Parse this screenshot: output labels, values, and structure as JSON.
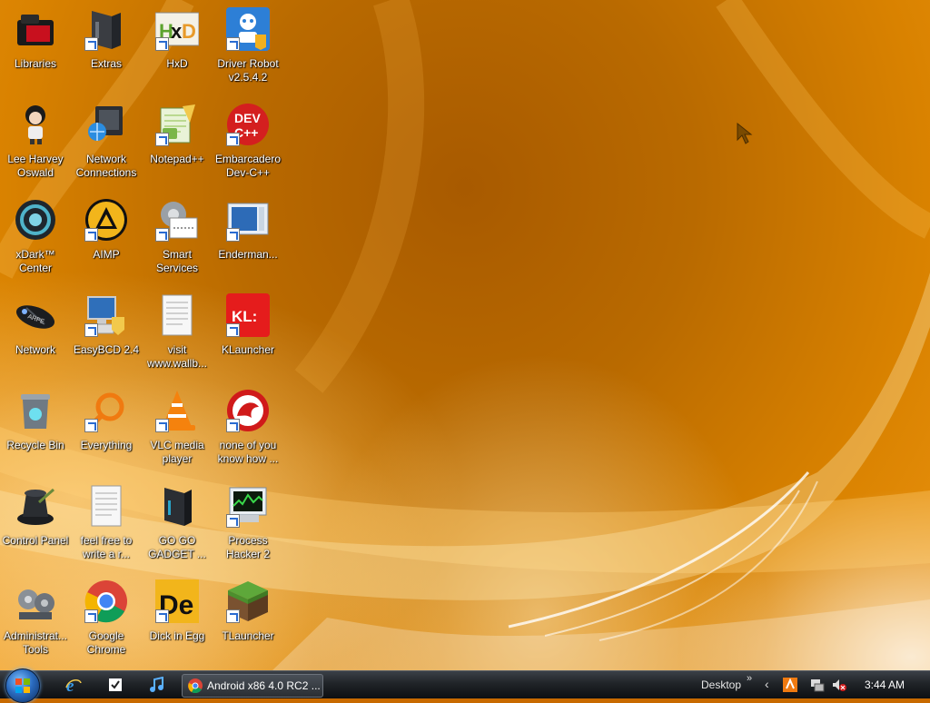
{
  "desktop": {
    "icons": [
      {
        "label": "Libraries",
        "icon": "libraries-icon"
      },
      {
        "label": "Extras",
        "icon": "folder-icon"
      },
      {
        "label": "HxD",
        "icon": "hxd-icon"
      },
      {
        "label": "Driver Robot\nv2.5.4.2",
        "icon": "driver-robot-icon"
      },
      {
        "label": "Lee Harvey\nOswald",
        "icon": "person-icon"
      },
      {
        "label": "Network\nConnections",
        "icon": "network-connections-icon"
      },
      {
        "label": "Notepad++",
        "icon": "notepad-icon"
      },
      {
        "label": "Embarcadero\nDev-C++",
        "icon": "devcpp-icon"
      },
      {
        "label": "xDark™\nCenter",
        "icon": "xdark-icon"
      },
      {
        "label": "AIMP",
        "icon": "aimp-icon"
      },
      {
        "label": "Smart\nServices",
        "icon": "gear-icon"
      },
      {
        "label": "Enderman...",
        "icon": "window-icon"
      },
      {
        "label": "Network",
        "icon": "network-icon"
      },
      {
        "label": "EasyBCD 2.4",
        "icon": "easybcd-icon"
      },
      {
        "label": "visit\nwww.wallb...",
        "icon": "document-icon"
      },
      {
        "label": "KLauncher",
        "icon": "klauncher-icon"
      },
      {
        "label": "Recycle Bin",
        "icon": "recycle-bin-icon"
      },
      {
        "label": "Everything",
        "icon": "search-icon"
      },
      {
        "label": "VLC media\nplayer",
        "icon": "vlc-icon"
      },
      {
        "label": "none of you\nknow how ...",
        "icon": "dragon-icon"
      },
      {
        "label": "Control Panel",
        "icon": "control-panel-icon"
      },
      {
        "label": "feel free to\nwrite a r...",
        "icon": "document-icon"
      },
      {
        "label": "GO GO\nGADGET ...",
        "icon": "folder-icon"
      },
      {
        "label": "Process\nHacker 2",
        "icon": "process-hacker-icon"
      },
      {
        "label": "Administrat...\nTools",
        "icon": "admin-tools-icon"
      },
      {
        "label": "Google\nChrome",
        "icon": "chrome-icon"
      },
      {
        "label": "Dick in Egg",
        "icon": "de-icon"
      },
      {
        "label": "TLauncher",
        "icon": "grass-block-icon"
      }
    ]
  },
  "taskbar": {
    "task_label": "Android x86 4.0 RC2 ...",
    "desktop_label": "Desktop",
    "chevron": "»",
    "tray_left": "‹",
    "clock": "3:44 AM"
  },
  "colors": {
    "accent": "#e08800",
    "taskbar": "#1a1d21"
  }
}
